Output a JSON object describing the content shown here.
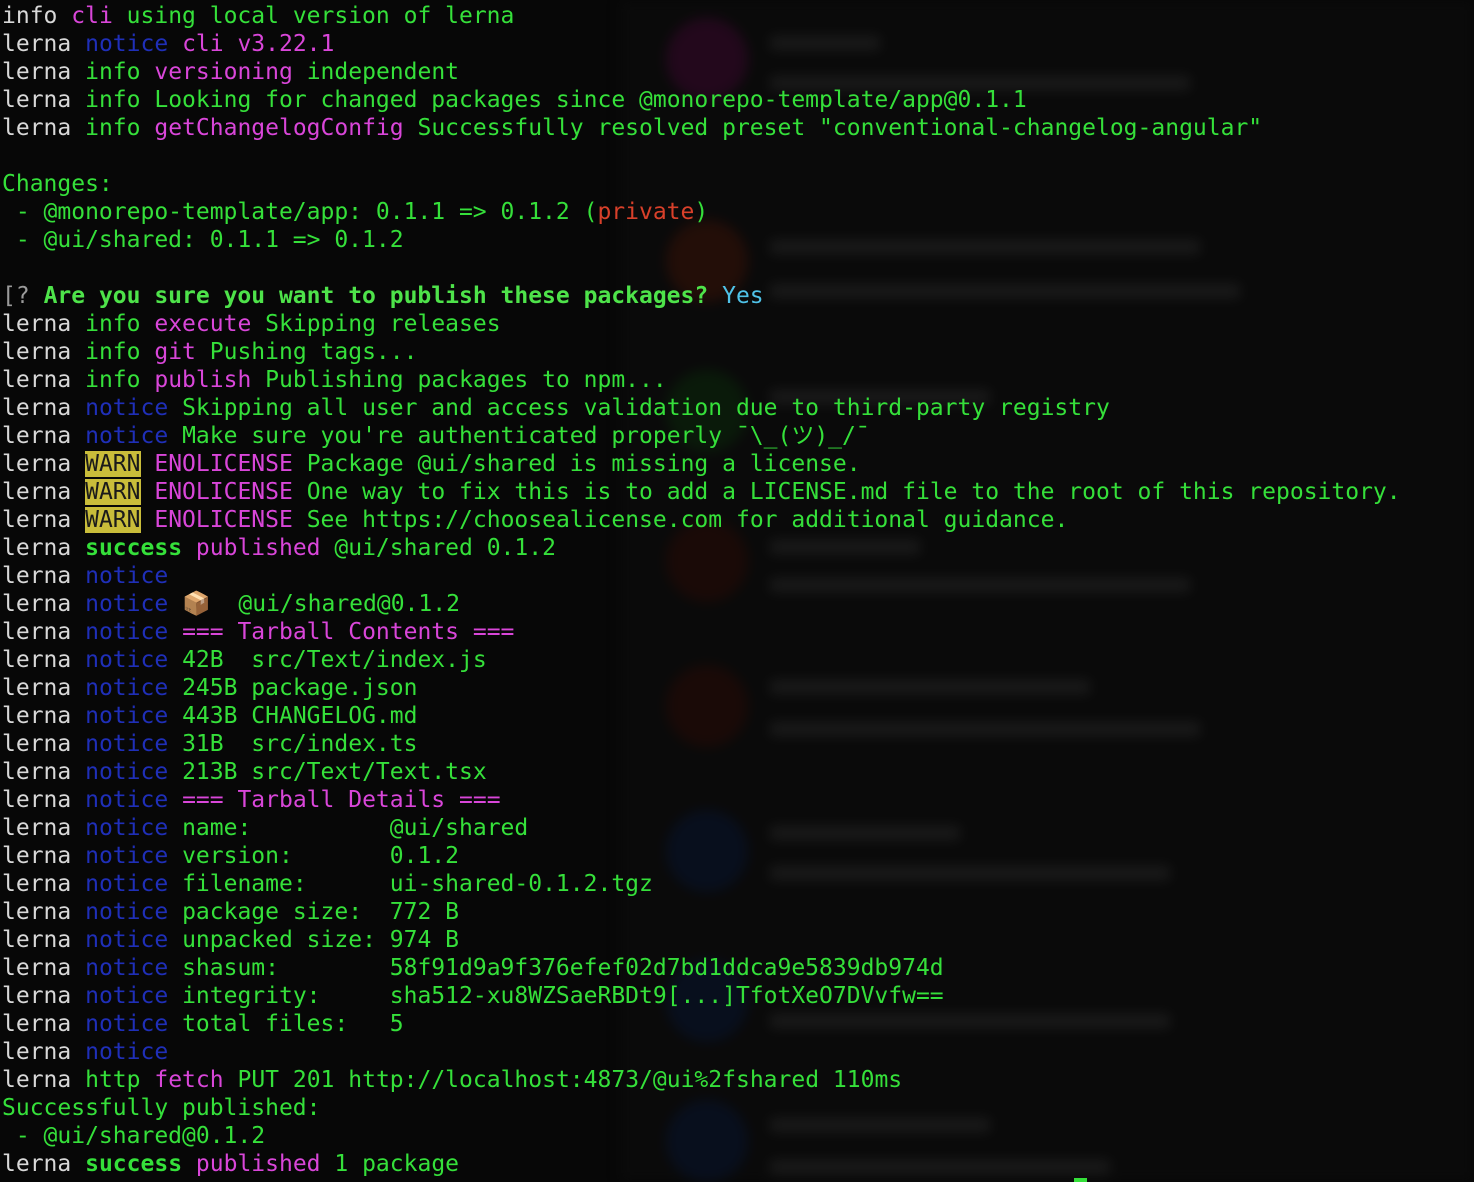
{
  "terminal": {
    "lines": [
      [
        [
          "info",
          "white"
        ],
        [
          "cli",
          "magenta"
        ],
        [
          "using local version of lerna",
          "green"
        ]
      ],
      [
        [
          "lerna",
          "white"
        ],
        [
          "notice",
          "blue"
        ],
        [
          "cli v3.22.1",
          "magenta"
        ]
      ],
      [
        [
          "lerna",
          "white"
        ],
        [
          "info",
          "green"
        ],
        [
          "versioning",
          "magenta"
        ],
        [
          "independent",
          "green"
        ]
      ],
      [
        [
          "lerna",
          "white"
        ],
        [
          "info",
          "green"
        ],
        [
          "Looking for changed packages since @monorepo-template/app@0.1.1",
          "green"
        ]
      ],
      [
        [
          "lerna",
          "white"
        ],
        [
          "info",
          "green"
        ],
        [
          "getChangelogConfig",
          "magenta"
        ],
        [
          "Successfully resolved preset \"conventional-changelog-angular\"",
          "green"
        ]
      ],
      [],
      [
        [
          "Changes:",
          "green"
        ]
      ],
      [
        [
          " - @monorepo-template/app: 0.1.1 => 0.1.2 (",
          "green"
        ],
        [
          "private",
          "red"
        ],
        [
          ")",
          "green"
        ]
      ],
      [
        [
          " - @ui/shared: 0.1.1 => 0.1.2",
          "green"
        ]
      ],
      [],
      [
        [
          "[?",
          "gray"
        ],
        [
          "Are you sure you want to publish these packages?",
          "boldq"
        ],
        [
          "Yes",
          "cyan"
        ]
      ],
      [
        [
          "lerna",
          "white"
        ],
        [
          "info",
          "green"
        ],
        [
          "execute",
          "magenta"
        ],
        [
          "Skipping releases",
          "green"
        ]
      ],
      [
        [
          "lerna",
          "white"
        ],
        [
          "info",
          "green"
        ],
        [
          "git",
          "magenta"
        ],
        [
          "Pushing tags...",
          "green"
        ]
      ],
      [
        [
          "lerna",
          "white"
        ],
        [
          "info",
          "green"
        ],
        [
          "publish",
          "magenta"
        ],
        [
          "Publishing packages to npm...",
          "green"
        ]
      ],
      [
        [
          "lerna",
          "white"
        ],
        [
          "notice",
          "blue"
        ],
        [
          "Skipping all user and access validation due to third-party registry",
          "green"
        ]
      ],
      [
        [
          "lerna",
          "white"
        ],
        [
          "notice",
          "blue"
        ],
        [
          "Make sure you're authenticated properly ¯\\_(ツ)_/¯",
          "green"
        ]
      ],
      [
        [
          "lerna",
          "white"
        ],
        [
          "WARN",
          "warn"
        ],
        [
          "ENOLICENSE",
          "magenta"
        ],
        [
          "Package @ui/shared is missing a license.",
          "green"
        ]
      ],
      [
        [
          "lerna",
          "white"
        ],
        [
          "WARN",
          "warn"
        ],
        [
          "ENOLICENSE",
          "magenta"
        ],
        [
          "One way to fix this is to add a LICENSE.md file to the root of this repository.",
          "green"
        ]
      ],
      [
        [
          "lerna",
          "white"
        ],
        [
          "WARN",
          "warn"
        ],
        [
          "ENOLICENSE",
          "magenta"
        ],
        [
          "See https://choosealicense.com for additional guidance.",
          "green"
        ]
      ],
      [
        [
          "lerna",
          "white"
        ],
        [
          "success",
          "success"
        ],
        [
          "published",
          "magenta"
        ],
        [
          "@ui/shared 0.1.2",
          "green"
        ]
      ],
      [
        [
          "lerna",
          "white"
        ],
        [
          "notice",
          "blue"
        ]
      ],
      [
        [
          "lerna",
          "white"
        ],
        [
          "notice",
          "blue"
        ],
        [
          "📦  @ui/shared@0.1.2",
          "green"
        ]
      ],
      [
        [
          "lerna",
          "white"
        ],
        [
          "notice",
          "blue"
        ],
        [
          "=== Tarball Contents ===",
          "magenta"
        ]
      ],
      [
        [
          "lerna",
          "white"
        ],
        [
          "notice",
          "blue"
        ],
        [
          "42B  src/Text/index.js",
          "green"
        ]
      ],
      [
        [
          "lerna",
          "white"
        ],
        [
          "notice",
          "blue"
        ],
        [
          "245B package.json",
          "green"
        ]
      ],
      [
        [
          "lerna",
          "white"
        ],
        [
          "notice",
          "blue"
        ],
        [
          "443B CHANGELOG.md",
          "green"
        ]
      ],
      [
        [
          "lerna",
          "white"
        ],
        [
          "notice",
          "blue"
        ],
        [
          "31B  src/index.ts",
          "green"
        ]
      ],
      [
        [
          "lerna",
          "white"
        ],
        [
          "notice",
          "blue"
        ],
        [
          "213B src/Text/Text.tsx",
          "green"
        ]
      ],
      [
        [
          "lerna",
          "white"
        ],
        [
          "notice",
          "blue"
        ],
        [
          "=== Tarball Details ===",
          "magenta"
        ]
      ],
      [
        [
          "lerna",
          "white"
        ],
        [
          "notice",
          "blue"
        ],
        [
          "name:          @ui/shared",
          "green"
        ]
      ],
      [
        [
          "lerna",
          "white"
        ],
        [
          "notice",
          "blue"
        ],
        [
          "version:       0.1.2",
          "green"
        ]
      ],
      [
        [
          "lerna",
          "white"
        ],
        [
          "notice",
          "blue"
        ],
        [
          "filename:      ui-shared-0.1.2.tgz",
          "green"
        ]
      ],
      [
        [
          "lerna",
          "white"
        ],
        [
          "notice",
          "blue"
        ],
        [
          "package size:  772 B",
          "green"
        ]
      ],
      [
        [
          "lerna",
          "white"
        ],
        [
          "notice",
          "blue"
        ],
        [
          "unpacked size: 974 B",
          "green"
        ]
      ],
      [
        [
          "lerna",
          "white"
        ],
        [
          "notice",
          "blue"
        ],
        [
          "shasum:        58f91d9a9f376efef02d7bd1ddca9e5839db974d",
          "green"
        ]
      ],
      [
        [
          "lerna",
          "white"
        ],
        [
          "notice",
          "blue"
        ],
        [
          "integrity:     sha512-xu8WZSaeRBDt9[...]TfotXeO7DVvfw==",
          "green"
        ]
      ],
      [
        [
          "lerna",
          "white"
        ],
        [
          "notice",
          "blue"
        ],
        [
          "total files:   5",
          "green"
        ]
      ],
      [
        [
          "lerna",
          "white"
        ],
        [
          "notice",
          "blue"
        ]
      ],
      [
        [
          "lerna",
          "white"
        ],
        [
          "http",
          "green"
        ],
        [
          "fetch",
          "magenta"
        ],
        [
          "PUT 201 http://localhost:4873/@ui%2fshared 110ms",
          "green"
        ]
      ],
      [
        [
          "Successfully published:",
          "green"
        ]
      ],
      [
        [
          " - @ui/shared@0.1.2",
          "green"
        ]
      ],
      [
        [
          "lerna",
          "white"
        ],
        [
          "success",
          "success"
        ],
        [
          "published",
          "magenta"
        ],
        [
          "1 package",
          "green"
        ]
      ]
    ]
  },
  "colors": {
    "background": "#070707",
    "text_green": "#35e03a",
    "notice_blue": "#1f2fb8",
    "magenta": "#d946d9",
    "warn_bg": "#c9bd3a",
    "private_red": "#d8402a",
    "answer_cyan": "#4fc2e8"
  }
}
